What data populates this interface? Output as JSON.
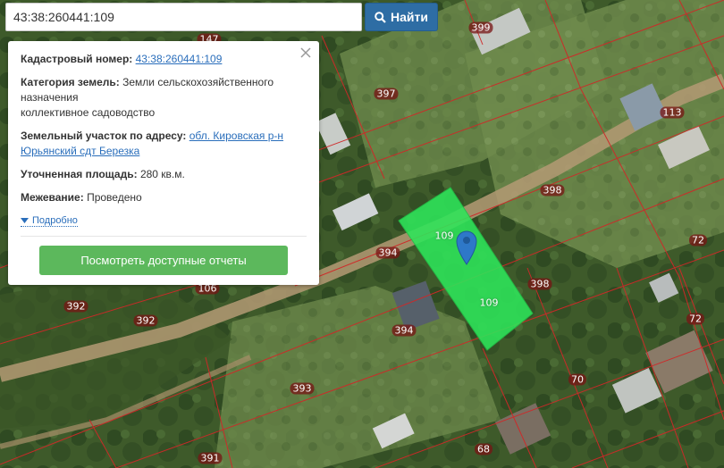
{
  "search": {
    "query": "43:38:260441:109",
    "button_label": "Найти"
  },
  "popup": {
    "cadastral_label": "Кадастровый номер:",
    "cadastral_value": "43:38:260441:109",
    "category_label": "Категория земель:",
    "category_value_1": "Земли сельскохозяйственного",
    "category_value_2": "назначения",
    "category_value_3": "коллективное садоводство",
    "address_label": "Земельный участок по адресу:",
    "address_value_1": "обл. Кировская р-н",
    "address_value_2": "Юрьянский сдт Березка",
    "area_label": "Уточненная площадь:",
    "area_value": "280 кв.м.",
    "survey_label": "Межевание:",
    "survey_value": "Проведено",
    "more_label": "Подробно",
    "reports_button": "Посмотреть доступные отчеты"
  },
  "map": {
    "parcel_labels": [
      "147",
      "399",
      "397",
      "113",
      "398",
      "72",
      "109",
      "394",
      "398",
      "106",
      "392",
      "392",
      "394",
      "72",
      "393",
      "70",
      "68",
      "391",
      "109"
    ],
    "highlight_color": "#2ee65a",
    "boundary_color": "#d02828"
  }
}
